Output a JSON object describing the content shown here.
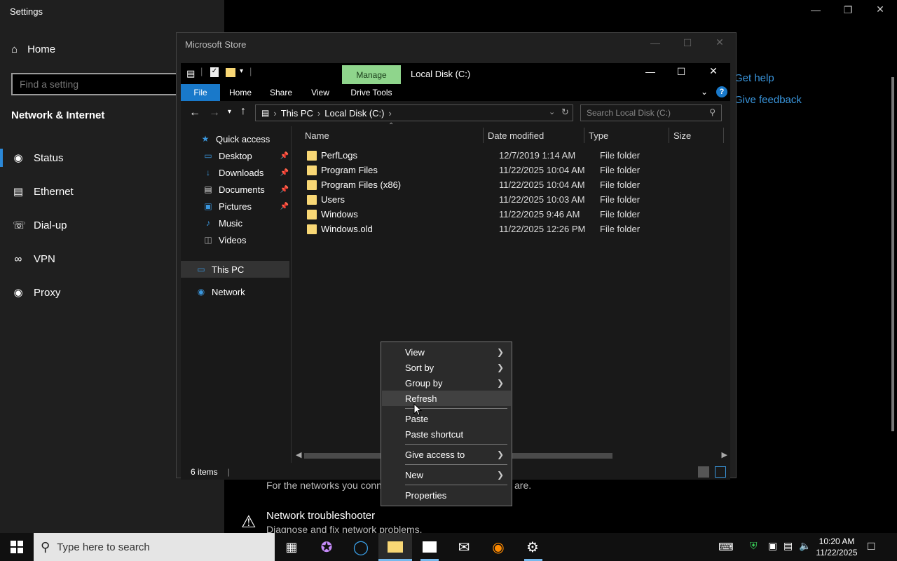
{
  "settings": {
    "title": "Settings",
    "home": "Home",
    "search_placeholder": "Find a setting",
    "category": "Network & Internet",
    "nav": [
      {
        "label": "Status",
        "icon": "globe-icon"
      },
      {
        "label": "Ethernet",
        "icon": "ethernet-icon"
      },
      {
        "label": "Dial-up",
        "icon": "dialup-icon"
      },
      {
        "label": "VPN",
        "icon": "vpn-icon"
      },
      {
        "label": "Proxy",
        "icon": "globe-icon"
      }
    ],
    "links": {
      "get_help": "Get help",
      "feedback": "Give feedback"
    },
    "body_text_1": "For the networks you connect to",
    "body_text_1_tail": "are.",
    "troubleshooter_title": "Network troubleshooter",
    "troubleshooter_desc": "Diagnose and fix network problems."
  },
  "msstore": {
    "title": "Microsoft Store"
  },
  "explorer": {
    "title": "Local Disk (C:)",
    "tabs": {
      "file": "File",
      "home": "Home",
      "share": "Share",
      "view": "View",
      "drive_tools": "Drive Tools",
      "manage": "Manage"
    },
    "breadcrumb": [
      "This PC",
      "Local Disk (C:)"
    ],
    "search_placeholder": "Search Local Disk (C:)",
    "nav": {
      "quick_access": "Quick access",
      "desktop": "Desktop",
      "downloads": "Downloads",
      "documents": "Documents",
      "pictures": "Pictures",
      "music": "Music",
      "videos": "Videos",
      "this_pc": "This PC",
      "network": "Network"
    },
    "columns": {
      "name": "Name",
      "date": "Date modified",
      "type": "Type",
      "size": "Size"
    },
    "files": [
      {
        "name": "PerfLogs",
        "date": "12/7/2019 1:14 AM",
        "type": "File folder"
      },
      {
        "name": "Program Files",
        "date": "11/22/2025 10:04 AM",
        "type": "File folder"
      },
      {
        "name": "Program Files (x86)",
        "date": "11/22/2025 10:04 AM",
        "type": "File folder"
      },
      {
        "name": "Users",
        "date": "11/22/2025 10:03 AM",
        "type": "File folder"
      },
      {
        "name": "Windows",
        "date": "11/22/2025 9:46 AM",
        "type": "File folder"
      },
      {
        "name": "Windows.old",
        "date": "11/22/2025 12:26 PM",
        "type": "File folder"
      }
    ],
    "status": "6 items"
  },
  "context_menu": {
    "view": "View",
    "sort_by": "Sort by",
    "group_by": "Group by",
    "refresh": "Refresh",
    "paste": "Paste",
    "paste_shortcut": "Paste shortcut",
    "give_access": "Give access to",
    "new": "New",
    "properties": "Properties"
  },
  "taskbar": {
    "search_placeholder": "Type here to search",
    "time": "10:20 AM",
    "date": "11/22/2025"
  },
  "colors": {
    "accent": "#1979ca",
    "manage_tab": "#8fd58c",
    "folder": "#f8d775",
    "link": "#3a96dd"
  }
}
